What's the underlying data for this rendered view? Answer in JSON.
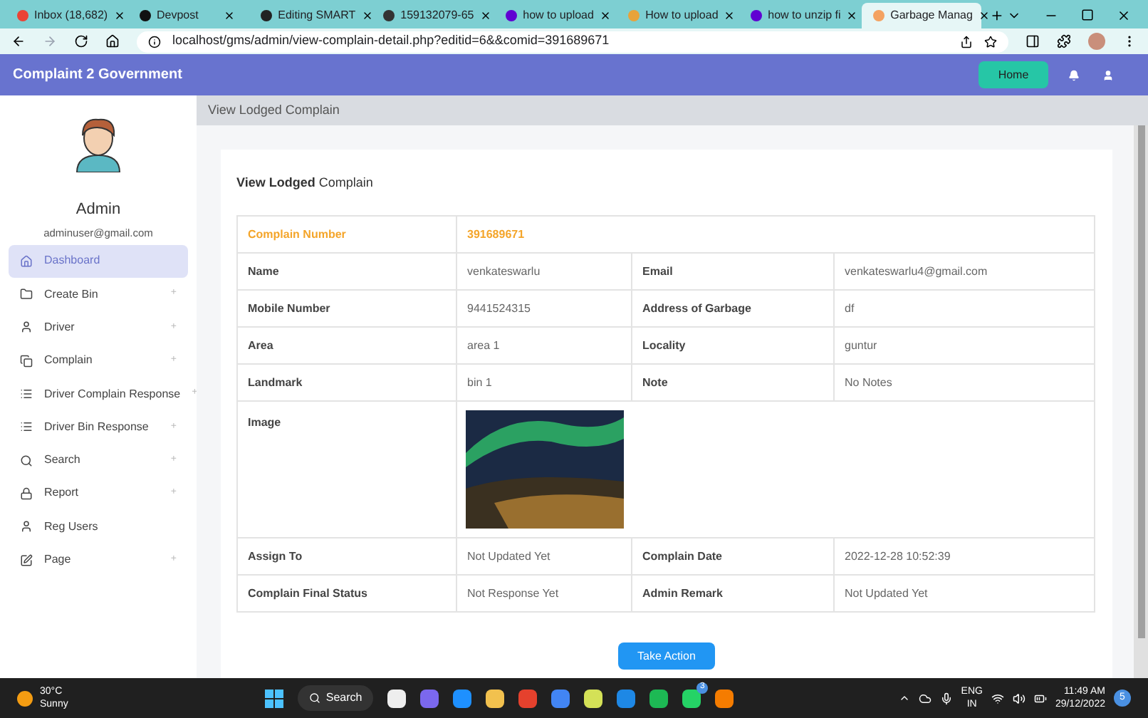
{
  "browser": {
    "tabs": [
      {
        "title": "Inbox (18,682)",
        "selected": false
      },
      {
        "title": "Devpost",
        "selected": false
      },
      {
        "title": "Editing SMART",
        "selected": false
      },
      {
        "title": "159132079-65",
        "selected": false
      },
      {
        "title": "how to upload",
        "selected": false
      },
      {
        "title": "How to upload",
        "selected": false
      },
      {
        "title": "how to unzip fi",
        "selected": false
      },
      {
        "title": "Garbage Manag",
        "selected": true
      }
    ],
    "url": "localhost/gms/admin/view-complain-detail.php?editid=6&&comid=391689671"
  },
  "header": {
    "brand": "Complaint 2 Government",
    "home_button": "Home"
  },
  "sidebar": {
    "user_name": "Admin",
    "user_email": "adminuser@gmail.com",
    "items": [
      {
        "label": "Dashboard",
        "selected": true
      },
      {
        "label": "Create Bin",
        "selected": false,
        "toggle": "+"
      },
      {
        "label": "Driver",
        "selected": false,
        "toggle": "+"
      },
      {
        "label": "Complain",
        "selected": false,
        "toggle": "+"
      },
      {
        "label": "Driver Complain Response",
        "selected": false,
        "toggle": "+"
      },
      {
        "label": "Driver Bin Response",
        "selected": false,
        "toggle": "+"
      },
      {
        "label": "Search",
        "selected": false,
        "toggle": "+"
      },
      {
        "label": "Report",
        "selected": false,
        "toggle": "+"
      },
      {
        "label": "Reg Users",
        "selected": false
      },
      {
        "label": "Page",
        "selected": false,
        "toggle": "+"
      }
    ]
  },
  "breadcrumb": "View Lodged Complain",
  "card": {
    "title_bold": "View Lodged",
    "title_rest": "Complain",
    "rows": [
      {
        "kind": "highlight",
        "label": "Complain Number",
        "value": "391689671"
      },
      {
        "kind": "pair",
        "label": "Name",
        "value": "venkateswarlu",
        "label_2": "Email",
        "value_2": "venkateswarlu4@gmail.com"
      },
      {
        "kind": "pair",
        "label": "Mobile Number",
        "value": "9441524315",
        "label_2": "Address of Garbage",
        "value_2": "df"
      },
      {
        "kind": "pair",
        "label": "Area",
        "value": "area 1",
        "label_2": "Locality",
        "value_2": "guntur"
      },
      {
        "kind": "pair",
        "label": "Landmark",
        "value": "bin 1",
        "label_2": "Note",
        "value_2": "No Notes"
      },
      {
        "kind": "image",
        "label": "Image"
      },
      {
        "kind": "pair",
        "label": "Assign To",
        "value": "Not Updated Yet",
        "label_2": "Complain Date",
        "value_2": "2022-12-28 10:52:39"
      },
      {
        "kind": "pair",
        "label": "Complain Final Status",
        "value": "Not Response Yet",
        "label_2": "Admin Remark",
        "value_2": "Not Updated Yet"
      }
    ],
    "action_button": "Take Action"
  },
  "taskbar": {
    "temperature": "30°C",
    "weather": "Sunny",
    "search": "Search",
    "whatsapp_badge": "3",
    "language": "ENG",
    "region": "IN",
    "time": "11:49 AM",
    "date": "29/12/2022",
    "notification_count": "5"
  }
}
